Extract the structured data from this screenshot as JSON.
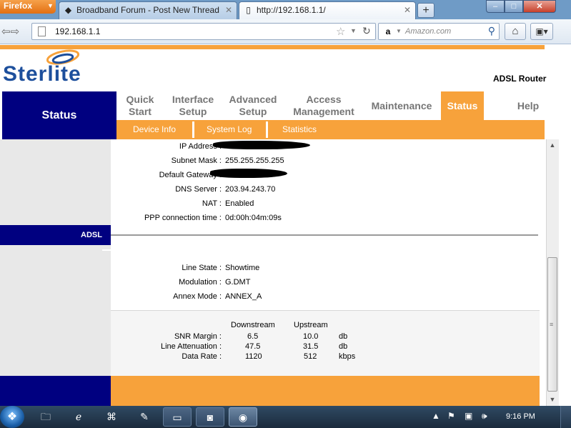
{
  "browser": {
    "menu_button": "Firefox",
    "tabs": [
      {
        "title": "Broadband Forum - Post New Thread",
        "active": false
      },
      {
        "title": "http://192.168.1.1/",
        "active": true
      }
    ],
    "new_tab": "+",
    "url": "192.168.1.1",
    "search_engine_placeholder": "Amazon.com"
  },
  "router": {
    "brand": "Sterlite",
    "product": "ADSL Router",
    "side_section": "Status",
    "menu": [
      {
        "label": "Quick Start"
      },
      {
        "label": "Interface Setup"
      },
      {
        "label": "Advanced Setup"
      },
      {
        "label": "Access Management"
      },
      {
        "label": "Maintenance"
      },
      {
        "label": "Status",
        "active": true
      },
      {
        "label": "Help"
      }
    ],
    "submenu": [
      {
        "label": "Device Info"
      },
      {
        "label": "System Log"
      },
      {
        "label": "Statistics"
      }
    ],
    "wan_info": [
      {
        "label": "IP Address :",
        "value": ""
      },
      {
        "label": "Subnet Mask :",
        "value": "255.255.255.255"
      },
      {
        "label": "Default Gateway :",
        "value": ""
      },
      {
        "label": "DNS Server :",
        "value": "203.94.243.70"
      },
      {
        "label": "NAT :",
        "value": "Enabled"
      },
      {
        "label": "PPP connection time :",
        "value": "0d:00h:04m:09s"
      }
    ],
    "adsl_section": "ADSL",
    "adsl_info": [
      {
        "label": "Line State :",
        "value": "Showtime"
      },
      {
        "label": "Modulation :",
        "value": "G.DMT"
      },
      {
        "label": "Annex Mode :",
        "value": "ANNEX_A"
      }
    ],
    "stats": {
      "headers": [
        "Downstream",
        "Upstream"
      ],
      "rows": [
        {
          "label": "SNR Margin :",
          "down": "6.5",
          "up": "10.0",
          "unit": "db"
        },
        {
          "label": "Line Attenuation :",
          "down": "47.5",
          "up": "31.5",
          "unit": "db"
        },
        {
          "label": "Data Rate :",
          "down": "1120",
          "up": "512",
          "unit": "kbps"
        }
      ]
    }
  },
  "taskbar": {
    "clock": "9:16 PM"
  },
  "colors": {
    "orange": "#f7a23b",
    "navy": "#000080",
    "brand_blue": "#1d4f9c"
  }
}
